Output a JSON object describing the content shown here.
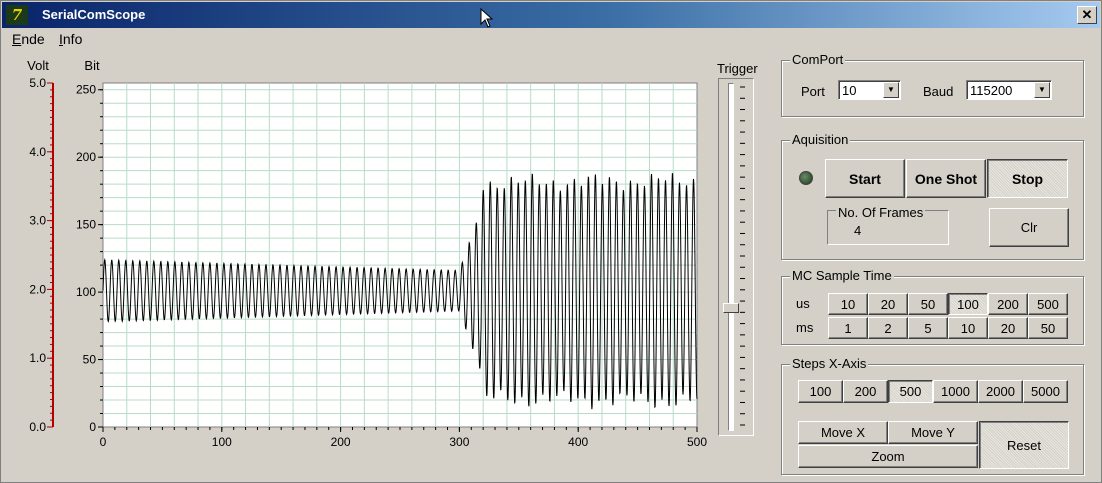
{
  "window": {
    "title": "SerialComScope",
    "close_label": "✕"
  },
  "menu": {
    "items": [
      {
        "underlined": "E",
        "rest": "nde"
      },
      {
        "underlined": "I",
        "rest": "nfo"
      }
    ]
  },
  "chart_data": {
    "type": "line",
    "y_volt_label": "Volt",
    "y_bit_label": "Bit",
    "x_ticks": [
      "0",
      "100",
      "200",
      "300",
      "400",
      "500"
    ],
    "y_volt_ticks": [
      "0.0",
      "1.0",
      "2.0",
      "3.0",
      "4.0",
      "5.0"
    ],
    "y_bit_ticks": [
      "0",
      "50",
      "100",
      "150",
      "200",
      "250"
    ],
    "xlim": [
      0,
      500
    ],
    "ylim_bit": [
      0,
      255
    ],
    "ylim_volt": [
      0,
      5
    ],
    "grid": true,
    "series": [
      {
        "segments": [
          {
            "x_start": 0,
            "x_end": 300,
            "center": 101,
            "amplitude_start": 23,
            "amplitude_end": 15,
            "period": 5.9
          },
          {
            "x_start": 300,
            "x_end": 318,
            "center": 101,
            "amplitude_start": 15,
            "amplitude_end": 60,
            "period": 5.9
          },
          {
            "x_start": 318,
            "x_end": 500,
            "center": 101,
            "amplitude_start": 80,
            "amplitude_end": 82,
            "period": 5.9
          }
        ]
      }
    ]
  },
  "trigger": {
    "label": "Trigger",
    "level_bit": 85
  },
  "comport": {
    "title": "ComPort",
    "port_label": "Port",
    "port_value": "10",
    "baud_label": "Baud",
    "baud_value": "115200"
  },
  "acquisition": {
    "title": "Aquisition",
    "start_label": "Start",
    "oneshot_label": "One Shot",
    "stop_label": "Stop",
    "frames_label": "No. Of Frames",
    "frames_value": "4",
    "clr_label": "Clr"
  },
  "sample_time": {
    "title": "MC Sample Time",
    "us_label": "us",
    "ms_label": "ms",
    "us_values": [
      "10",
      "20",
      "50",
      "100",
      "200",
      "500"
    ],
    "ms_values": [
      "1",
      "2",
      "5",
      "10",
      "20",
      "50"
    ],
    "selected_us": "100"
  },
  "steps_x": {
    "title": "Steps X-Axis",
    "values": [
      "100",
      "200",
      "500",
      "1000",
      "2000",
      "5000"
    ],
    "selected": "500",
    "move_x_label": "Move X",
    "move_y_label": "Move Y",
    "zoom_label": "Zoom",
    "reset_label": "Reset"
  },
  "colors": {
    "plot_bg": "#ffffff",
    "grid": "#b8dcc8",
    "signal": "#000000",
    "volt_axis": "#b00000"
  }
}
